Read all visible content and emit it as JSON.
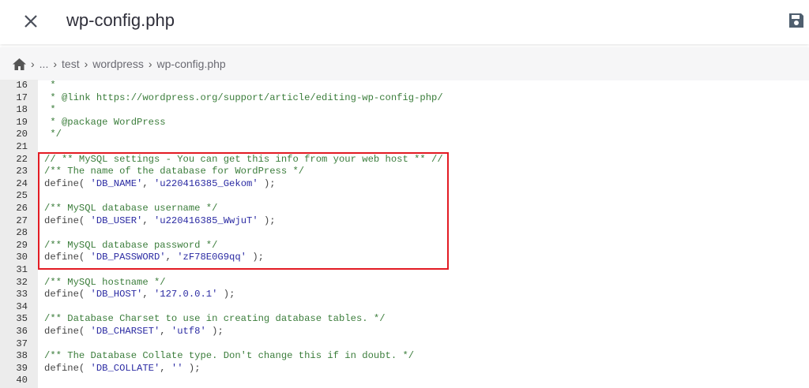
{
  "header": {
    "title": "wp-config.php",
    "close_icon": "close-icon",
    "save_icon": "save-icon"
  },
  "breadcrumb": {
    "home_icon": "home-icon",
    "items": [
      "...",
      "test",
      "wordpress",
      "wp-config.php"
    ]
  },
  "colors": {
    "comment": "#3b7d3b",
    "string": "#2b2ba3",
    "highlight": "#e31b23"
  },
  "editor": {
    "lines": [
      {
        "n": "16",
        "seg": [
          [
            "c",
            " *"
          ]
        ]
      },
      {
        "n": "17",
        "seg": [
          [
            "c",
            " * @link https://wordpress.org/support/article/editing-wp-config-php/"
          ]
        ]
      },
      {
        "n": "18",
        "seg": [
          [
            "c",
            " *"
          ]
        ]
      },
      {
        "n": "19",
        "seg": [
          [
            "c",
            " * @package WordPress"
          ]
        ]
      },
      {
        "n": "20",
        "seg": [
          [
            "c",
            " */"
          ]
        ]
      },
      {
        "n": "21",
        "seg": []
      },
      {
        "n": "22",
        "seg": [
          [
            "c",
            "// ** MySQL settings - You can get this info from your web host ** //"
          ]
        ]
      },
      {
        "n": "23",
        "seg": [
          [
            "c",
            "/** The name of the database for WordPress */"
          ]
        ]
      },
      {
        "n": "24",
        "seg": [
          [
            "p",
            "define( "
          ],
          [
            "s",
            "'DB_NAME'"
          ],
          [
            "p",
            ", "
          ],
          [
            "s",
            "'u220416385_Gekom'"
          ],
          [
            "p",
            " );"
          ]
        ]
      },
      {
        "n": "25",
        "seg": []
      },
      {
        "n": "26",
        "seg": [
          [
            "c",
            "/** MySQL database username */"
          ]
        ]
      },
      {
        "n": "27",
        "seg": [
          [
            "p",
            "define( "
          ],
          [
            "s",
            "'DB_USER'"
          ],
          [
            "p",
            ", "
          ],
          [
            "s",
            "'u220416385_WwjuT'"
          ],
          [
            "p",
            " );"
          ]
        ]
      },
      {
        "n": "28",
        "seg": []
      },
      {
        "n": "29",
        "seg": [
          [
            "c",
            "/** MySQL database password */"
          ]
        ]
      },
      {
        "n": "30",
        "seg": [
          [
            "p",
            "define( "
          ],
          [
            "s",
            "'DB_PASSWORD'"
          ],
          [
            "p",
            ", "
          ],
          [
            "s",
            "'zF78E0G9qq'"
          ],
          [
            "p",
            " );"
          ]
        ]
      },
      {
        "n": "31",
        "seg": []
      },
      {
        "n": "32",
        "seg": [
          [
            "c",
            "/** MySQL hostname */"
          ]
        ]
      },
      {
        "n": "33",
        "seg": [
          [
            "p",
            "define( "
          ],
          [
            "s",
            "'DB_HOST'"
          ],
          [
            "p",
            ", "
          ],
          [
            "s",
            "'127.0.0.1'"
          ],
          [
            "p",
            " );"
          ]
        ]
      },
      {
        "n": "34",
        "seg": []
      },
      {
        "n": "35",
        "seg": [
          [
            "c",
            "/** Database Charset to use in creating database tables. */"
          ]
        ]
      },
      {
        "n": "36",
        "seg": [
          [
            "p",
            "define( "
          ],
          [
            "s",
            "'DB_CHARSET'"
          ],
          [
            "p",
            ", "
          ],
          [
            "s",
            "'utf8'"
          ],
          [
            "p",
            " );"
          ]
        ]
      },
      {
        "n": "37",
        "seg": []
      },
      {
        "n": "38",
        "seg": [
          [
            "c",
            "/** The Database Collate type. Don't change this if in doubt. */"
          ]
        ]
      },
      {
        "n": "39",
        "seg": [
          [
            "p",
            "define( "
          ],
          [
            "s",
            "'DB_COLLATE'"
          ],
          [
            "p",
            ", "
          ],
          [
            "s",
            "''"
          ],
          [
            "p",
            " );"
          ]
        ]
      },
      {
        "n": "40",
        "seg": []
      }
    ]
  }
}
